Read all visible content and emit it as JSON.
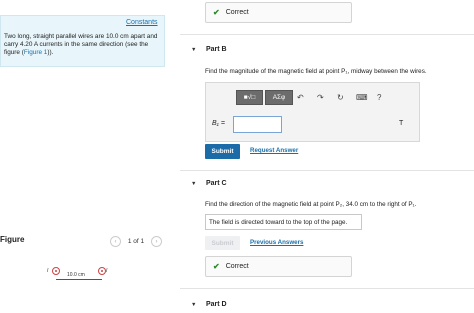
{
  "problem": {
    "constants_label": "Constants",
    "text_before_link": "Two long, straight parallel wires are 10.0 cm apart and carry 4.20 A currents in the same direction (see the figure (",
    "link_text": "Figure 1",
    "text_after_link": "))."
  },
  "figure": {
    "label": "Figure",
    "pager": "1 of 1",
    "prev_glyph": "‹",
    "next_glyph": "›",
    "wire_left_label": "I",
    "wire_right_label": "I",
    "distance_label": "10.0 cm"
  },
  "part_a": {
    "status": "Correct",
    "check_glyph": "✔"
  },
  "part_b": {
    "caret": "▼",
    "title": "Part B",
    "question": "Find the magnitude of the magnetic field at point P₁, midway between the wires.",
    "toolbar": {
      "template_glyph": "■√□",
      "greek_label": "ΑΣφ",
      "undo_glyph": "↶",
      "redo_glyph": "↷",
      "reset_glyph": "↻",
      "keyboard_glyph": "⌨",
      "help_glyph": "?"
    },
    "variable_label": "B₁ =",
    "input_value": "",
    "unit": "T",
    "submit_label": "Submit",
    "request_answer_label": "Request Answer"
  },
  "part_c": {
    "caret": "▼",
    "title": "Part C",
    "question": "Find the direction of the magnetic field at point P₂, 34.0 cm to the right of P₁.",
    "answer_text": "The field is directed toward to the top of the page.",
    "submit_label": "Submit",
    "previous_answers_label": "Previous Answers",
    "status": "Correct",
    "check_glyph": "✔"
  },
  "part_d": {
    "caret": "▼",
    "title": "Part D"
  },
  "colors": {
    "accent": "#1b6ba8",
    "success": "#2e8b2e",
    "problem_bg": "#e8f6fb"
  }
}
